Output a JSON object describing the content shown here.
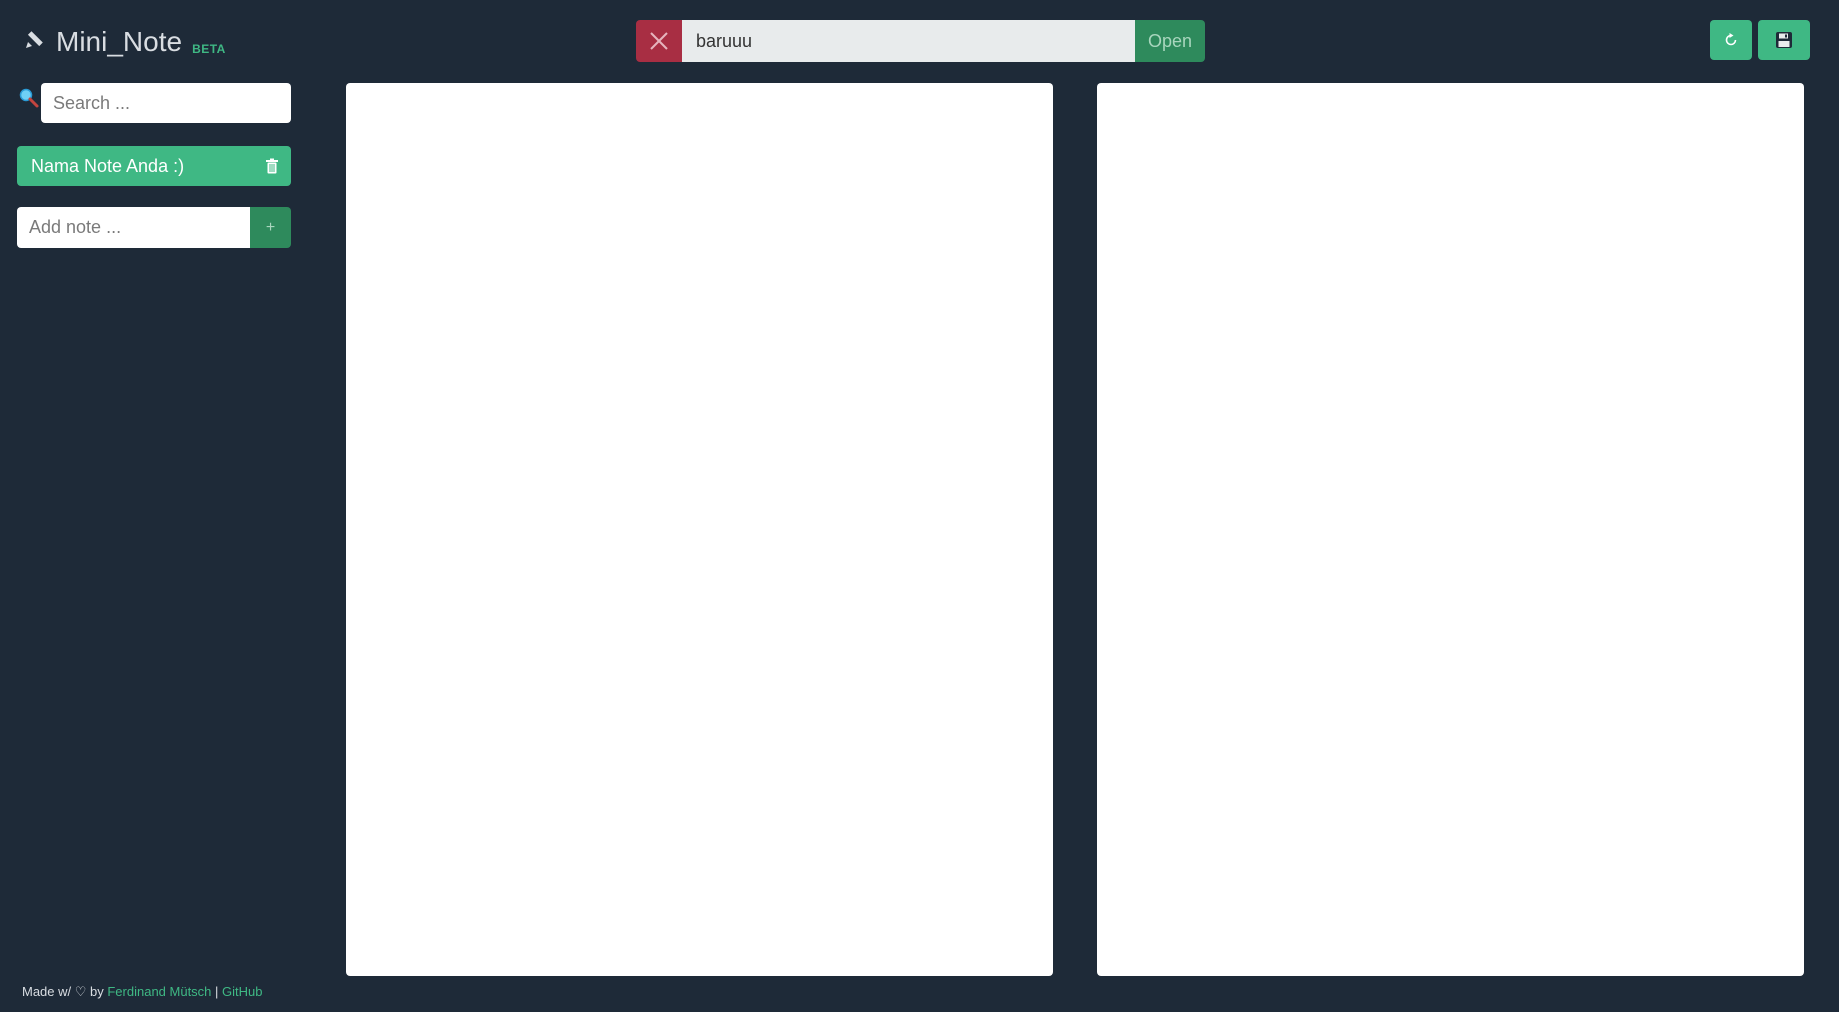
{
  "header": {
    "app_title": "Mini_Note",
    "badge": "BETA",
    "path_value": "baruuu",
    "open_label": "Open",
    "refresh_icon": "refresh-icon",
    "save_icon": "floppy-disk-icon"
  },
  "sidebar": {
    "search_placeholder": "Search ...",
    "notes": [
      {
        "label": "Nama Note Anda :)"
      }
    ],
    "add_placeholder": "Add note ...",
    "add_label": "+"
  },
  "footer": {
    "prefix": "Made w/ ♡ by ",
    "author": "Ferdinand Mütsch",
    "separator": " | ",
    "github": "GitHub"
  },
  "colors": {
    "background": "#1e2a38",
    "accent": "#3fb884",
    "accent_dark": "#2e8a5c",
    "danger": "#a82e43"
  }
}
